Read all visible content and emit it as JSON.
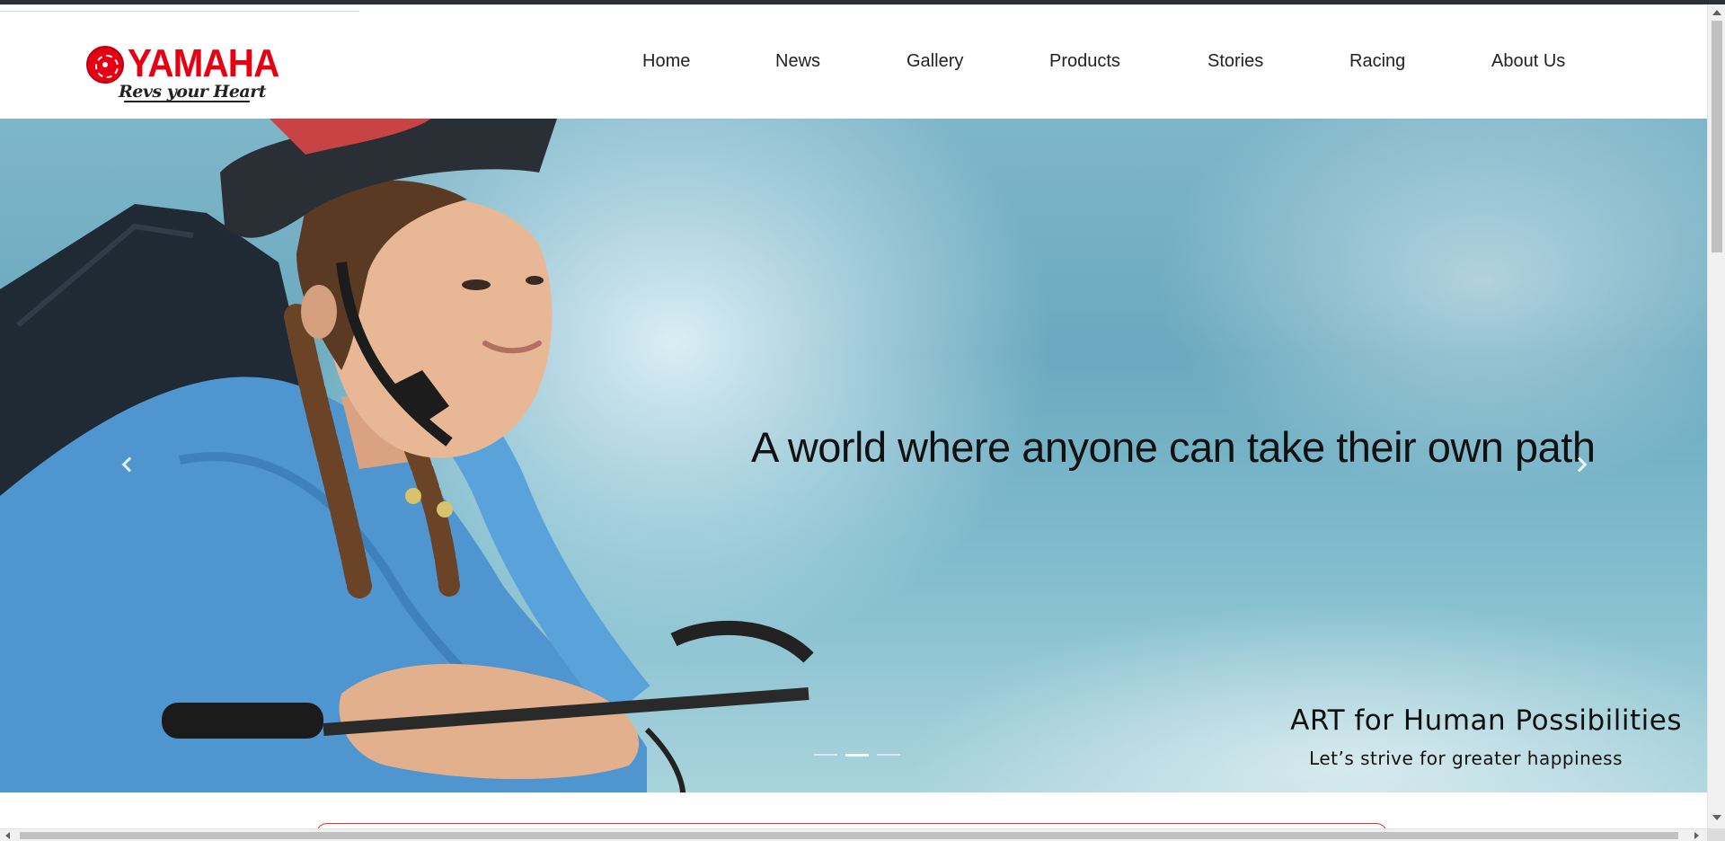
{
  "brand": {
    "name": "YAMAHA",
    "tagline": "Revs your Heart",
    "primary_color": "#e60012",
    "icon": "tuning-fork-emblem-icon"
  },
  "nav": {
    "items": [
      {
        "label": "Home"
      },
      {
        "label": "News"
      },
      {
        "label": "Gallery"
      },
      {
        "label": "Products"
      },
      {
        "label": "Stories"
      },
      {
        "label": "Racing"
      },
      {
        "label": "About Us"
      }
    ]
  },
  "hero": {
    "headline": "A world where anyone can take their own path",
    "art_title": "ART for Human Possibilities",
    "art_subtitle": "Let’s strive for greater happiness",
    "prev_icon": "chevron-left-icon",
    "next_icon": "chevron-right-icon",
    "slides_total": 3,
    "active_slide": 2
  }
}
